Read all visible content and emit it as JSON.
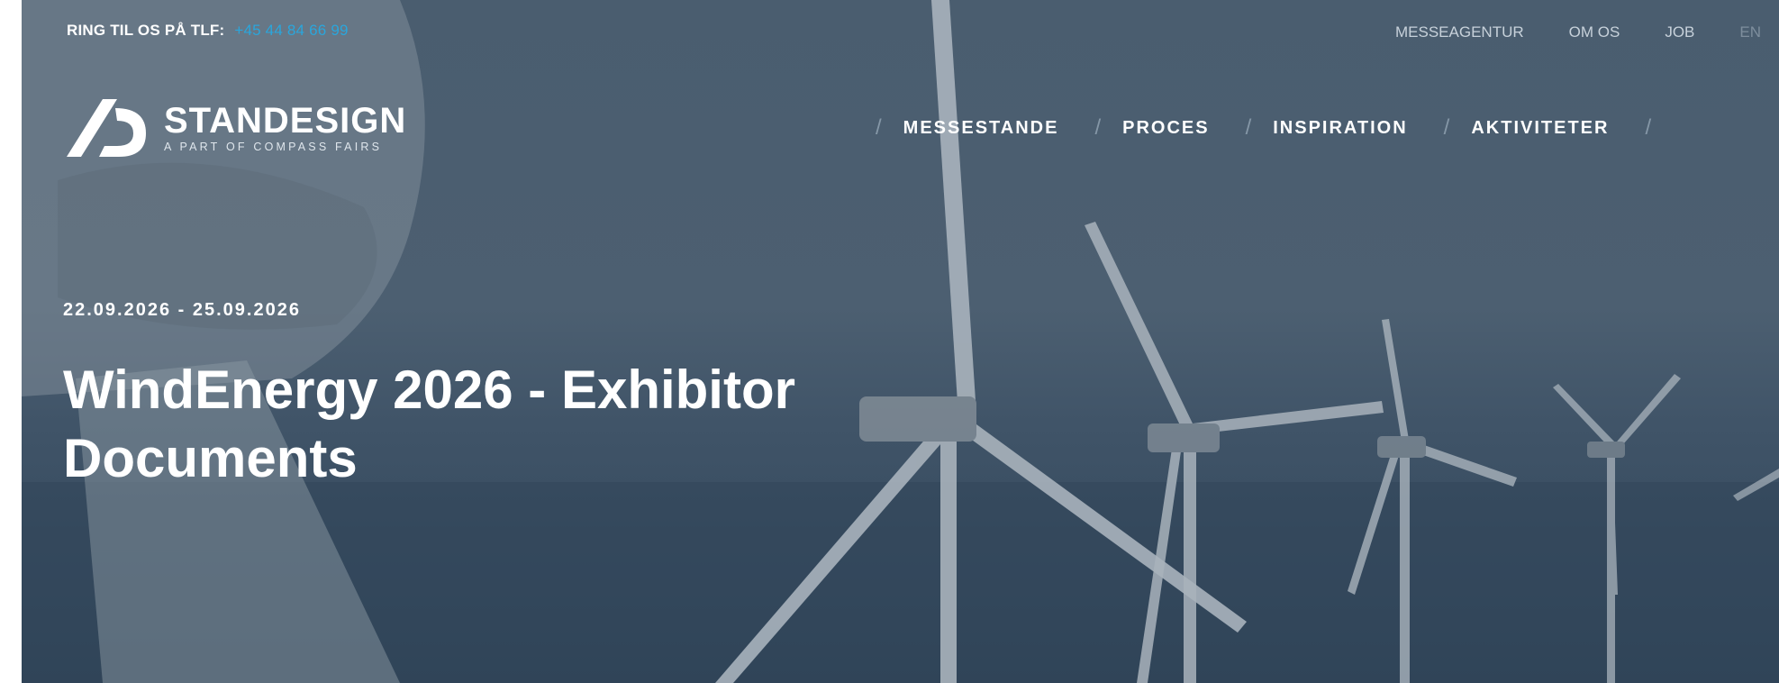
{
  "topbar": {
    "label": "RING TIL OS PÅ TLF:",
    "phone": "+45 44 84 66 99"
  },
  "topnav": [
    "MESSEAGENTUR",
    "OM OS",
    "JOB",
    "EN"
  ],
  "logo": {
    "name": "STANDESIGN",
    "tagline": "A PART OF COMPASS FAIRS",
    "icon": "standesign-logo-icon"
  },
  "mainnav": [
    "MESSESTANDE",
    "PROCES",
    "INSPIRATION",
    "AKTIVITETER"
  ],
  "hero": {
    "date": "22.09.2026 - 25.09.2026",
    "title": "WindEnergy 2026 - Exhibitor Documents"
  },
  "colors": {
    "accent": "#2aa6dc",
    "overlay": "#4a5d6f"
  }
}
